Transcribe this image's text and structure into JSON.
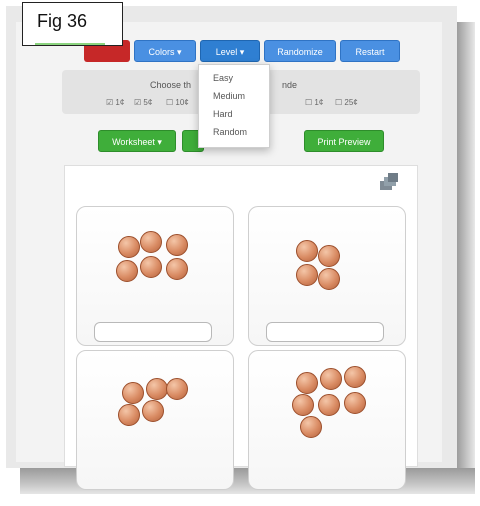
{
  "figure_label": "Fig 36",
  "toolbar": {
    "colors_label": "Colors ▾",
    "level_label": "Level ▾",
    "randomize_label": "Randomize",
    "restart_label": "Restart"
  },
  "level_menu": {
    "items": [
      "Easy",
      "Medium",
      "Hard",
      "Random"
    ]
  },
  "choose_row": {
    "prefix": "Choose th",
    "suffix": "nde",
    "options": [
      "1¢",
      "5¢",
      "10¢",
      "25¢"
    ],
    "right_options": [
      "1¢",
      "25¢"
    ]
  },
  "actions": {
    "worksheet_label": "Worksheet ▾",
    "print_label": "Print Preview"
  },
  "cards": [
    {
      "coins": 6
    },
    {
      "coins": 4
    },
    {
      "coins": 5
    },
    {
      "coins": 7
    }
  ],
  "colors": {
    "primary": "#2f7fd2",
    "danger": "#c62828",
    "success": "#3fae3a",
    "coin": "#d98b63"
  }
}
